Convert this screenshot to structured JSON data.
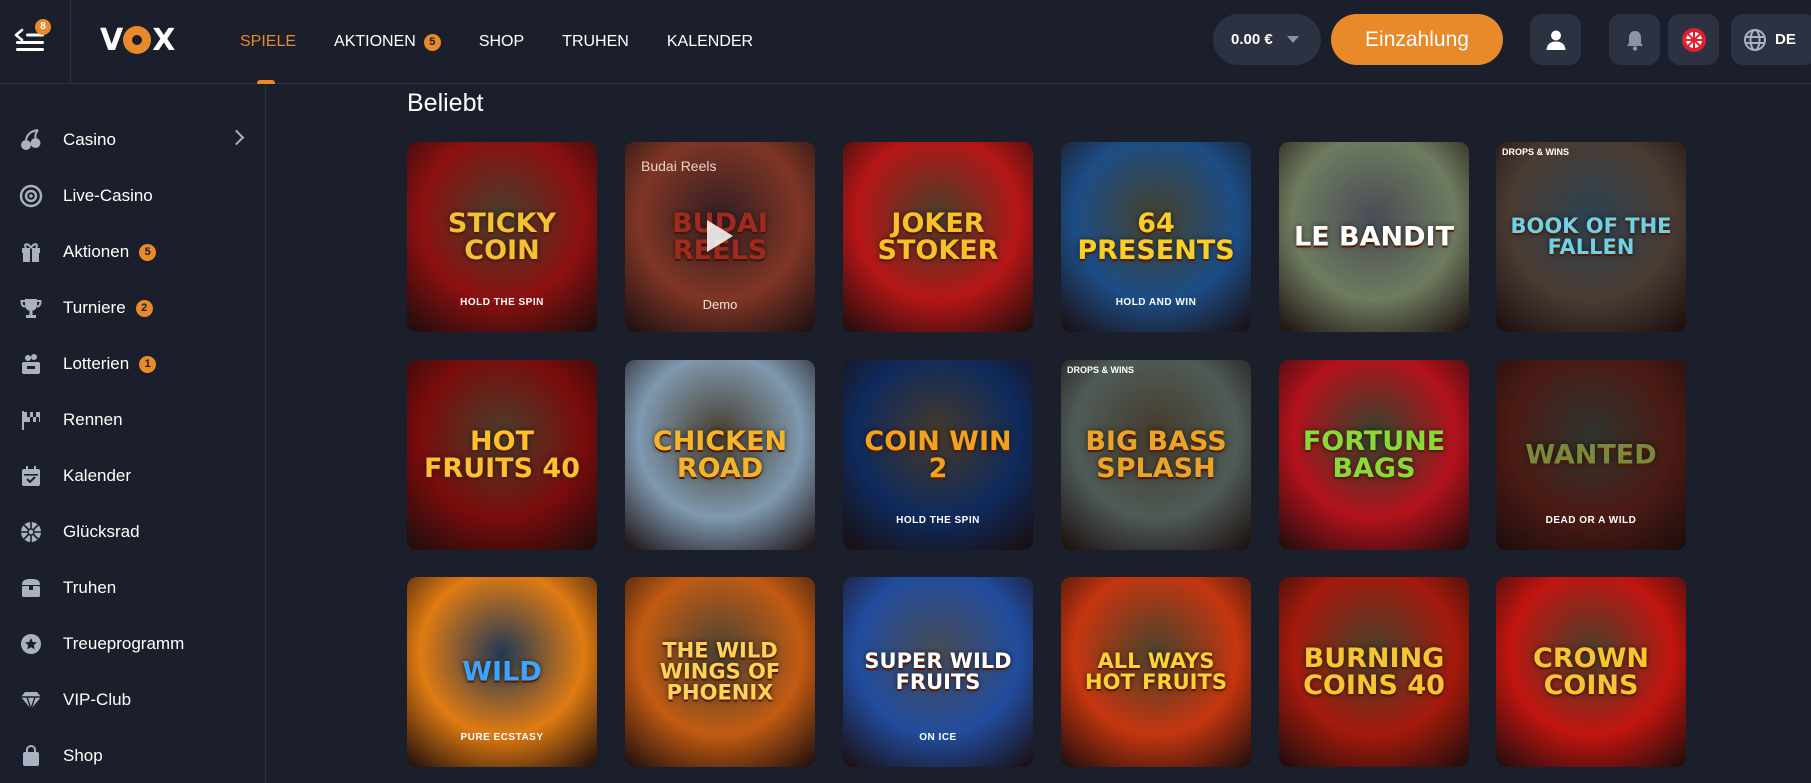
{
  "header": {
    "menu_badge": "8",
    "logo_left": "V",
    "logo_right": "X",
    "nav": [
      {
        "label": "SPIELE",
        "active": true
      },
      {
        "label": "AKTIONEN",
        "badge": "5"
      },
      {
        "label": "SHOP"
      },
      {
        "label": "TRUHEN"
      },
      {
        "label": "KALENDER"
      }
    ],
    "balance": "0.00 €",
    "deposit_label": "Einzahlung",
    "language": "DE"
  },
  "sidebar": {
    "items": [
      {
        "label": "Casino",
        "icon": "cherries-icon",
        "has_arrow": true
      },
      {
        "label": "Live-Casino",
        "icon": "roulette-icon"
      },
      {
        "label": "Aktionen",
        "icon": "gift-icon",
        "badge": "5"
      },
      {
        "label": "Turniere",
        "icon": "trophy-icon",
        "badge": "2"
      },
      {
        "label": "Lotterien",
        "icon": "lottery-icon",
        "badge": "1"
      },
      {
        "label": "Rennen",
        "icon": "racing-flag-icon"
      },
      {
        "label": "Kalender",
        "icon": "calendar-icon"
      },
      {
        "label": "Glücksrad",
        "icon": "wheel-icon"
      },
      {
        "label": "Truhen",
        "icon": "chest-icon"
      },
      {
        "label": "Treueprogramm",
        "icon": "loyalty-icon"
      },
      {
        "label": "VIP-Club",
        "icon": "diamond-icon"
      },
      {
        "label": "Shop",
        "icon": "bag-icon"
      }
    ]
  },
  "main": {
    "section_title": "Beliebt",
    "hover": {
      "title": "Budai Reels",
      "demo": "Demo"
    },
    "games": [
      {
        "title": "Sticky Coin",
        "sub": "Hold the Spin",
        "bg": "#8c1010",
        "accent": "#f2c233"
      },
      {
        "title": "Budai Reels",
        "sub": "",
        "bg": "#b8482a",
        "accent": "#e8381f"
      },
      {
        "title": "Joker Stoker",
        "sub": "",
        "bg": "#b51616",
        "accent": "#f6c12b"
      },
      {
        "title": "64 Presents",
        "sub": "Hold and Win",
        "bg": "#1c4d86",
        "accent": "#f5d02a"
      },
      {
        "title": "Le Bandit",
        "sub": "",
        "bg": "#6e7b5f",
        "accent": "#ffffff"
      },
      {
        "title": "Book of the Fallen",
        "sub": "",
        "bg": "#4a3b33",
        "accent": "#6fd0e6",
        "corner": "DROPS & WINS"
      },
      {
        "title": "Hot Fruits 40",
        "sub": "",
        "bg": "#7a0c0c",
        "accent": "#ffbf2e"
      },
      {
        "title": "Chicken Road",
        "sub": "",
        "bg": "#7f99b0",
        "accent": "#f5b52b"
      },
      {
        "title": "Coin Win 2",
        "sub": "Hold the Spin",
        "bg": "#0f2a5c",
        "accent": "#f2a21f"
      },
      {
        "title": "Big Bass Splash",
        "sub": "",
        "bg": "#4f5b57",
        "accent": "#e8a529",
        "corner": "DROPS & WINS"
      },
      {
        "title": "Fortune Bags",
        "sub": "",
        "bg": "#b3121c",
        "accent": "#8ad93a"
      },
      {
        "title": "Wanted",
        "sub": "Dead or a Wild",
        "bg": "#4b1a14",
        "accent": "#7a8a3a"
      },
      {
        "title": "Wild",
        "sub": "Pure Ecstasy",
        "bg": "#e07b12",
        "accent": "#3aa4ff"
      },
      {
        "title": "The Wild Wings of Phoenix",
        "sub": "",
        "bg": "#c25b12",
        "accent": "#ffd25a"
      },
      {
        "title": "Super Wild Fruits",
        "sub": "On Ice",
        "bg": "#214c9e",
        "accent": "#ffffff"
      },
      {
        "title": "All Ways Hot Fruits",
        "sub": "",
        "bg": "#c5360f",
        "accent": "#ffd233"
      },
      {
        "title": "Burning Coins 40",
        "sub": "",
        "bg": "#a51a0c",
        "accent": "#f7c531"
      },
      {
        "title": "Crown Coins",
        "sub": "",
        "bg": "#c1150f",
        "accent": "#f7c531"
      }
    ]
  }
}
